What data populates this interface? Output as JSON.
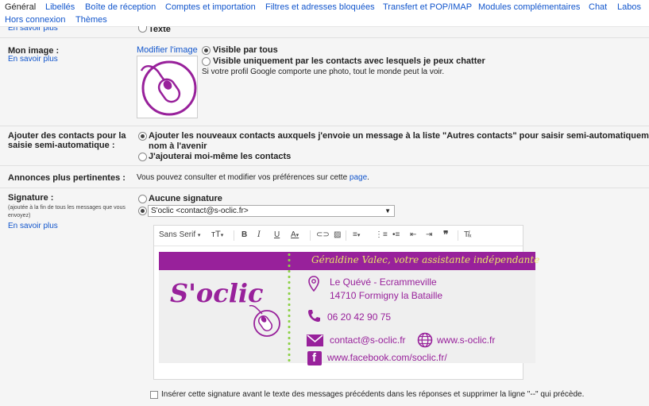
{
  "tabs": [
    "Général",
    "Libellés",
    "Boîte de réception",
    "Comptes et importation",
    "Filtres et adresses bloquées",
    "Transfert et POP/IMAP",
    "Modules complémentaires",
    "Chat",
    "Labos",
    "Hors connexion",
    "Thèmes"
  ],
  "top_fragment": {
    "left": "En savoir plus",
    "right": "Texte"
  },
  "image_section": {
    "label": "Mon image :",
    "learn_more": "En savoir plus",
    "modify": "Modifier l'image",
    "opt1": "Visible par tous",
    "opt2": "Visible uniquement par les contacts avec lesquels je peux chatter",
    "note": "Si votre profil Google comporte une photo, tout le monde peut la voir."
  },
  "contacts_section": {
    "label_line1": "Ajouter des contacts pour la",
    "label_line2": "saisie semi-automatique :",
    "opt1_line1": "Ajouter les nouveaux contacts auxquels j'envoie un message à la liste \"Autres contacts\" pour saisir semi-automatiquement leur",
    "opt1_line2": "nom à l'avenir",
    "opt2": "J'ajouterai moi-même les contacts"
  },
  "ads_section": {
    "label": "Annonces plus pertinentes :",
    "text": "Vous pouvez consulter et modifier vos préférences sur cette",
    "link": "page",
    "period": "."
  },
  "signature_section": {
    "label": "Signature :",
    "hint_line1": "(ajoutée à la fin de tous les messages que vous",
    "hint_line2": "envoyez)",
    "learn_more": "En savoir plus",
    "opt_none": "Aucune signature",
    "selected_account": "S'oclic <contact@s-oclic.fr>",
    "font": "Sans Serif",
    "checkbox_label": "Insérer cette signature avant le texte des messages précédents dans les réponses et supprimer la ligne \"--\" qui précède."
  },
  "signature_card": {
    "name": "Géraldine Valec, votre assistante indépendante",
    "logo": "S'oclic",
    "address_line1": "Le Quévé - Ecrammeville",
    "address_line2": "14710 Formigny la Bataille",
    "phone": "06 20 42 90 75",
    "email": "contact@s-oclic.fr",
    "website": "www.s-oclic.fr",
    "facebook": "www.facebook.com/soclic.fr/",
    "brand_color": "#98219b",
    "accent_color": "#8ed148"
  }
}
